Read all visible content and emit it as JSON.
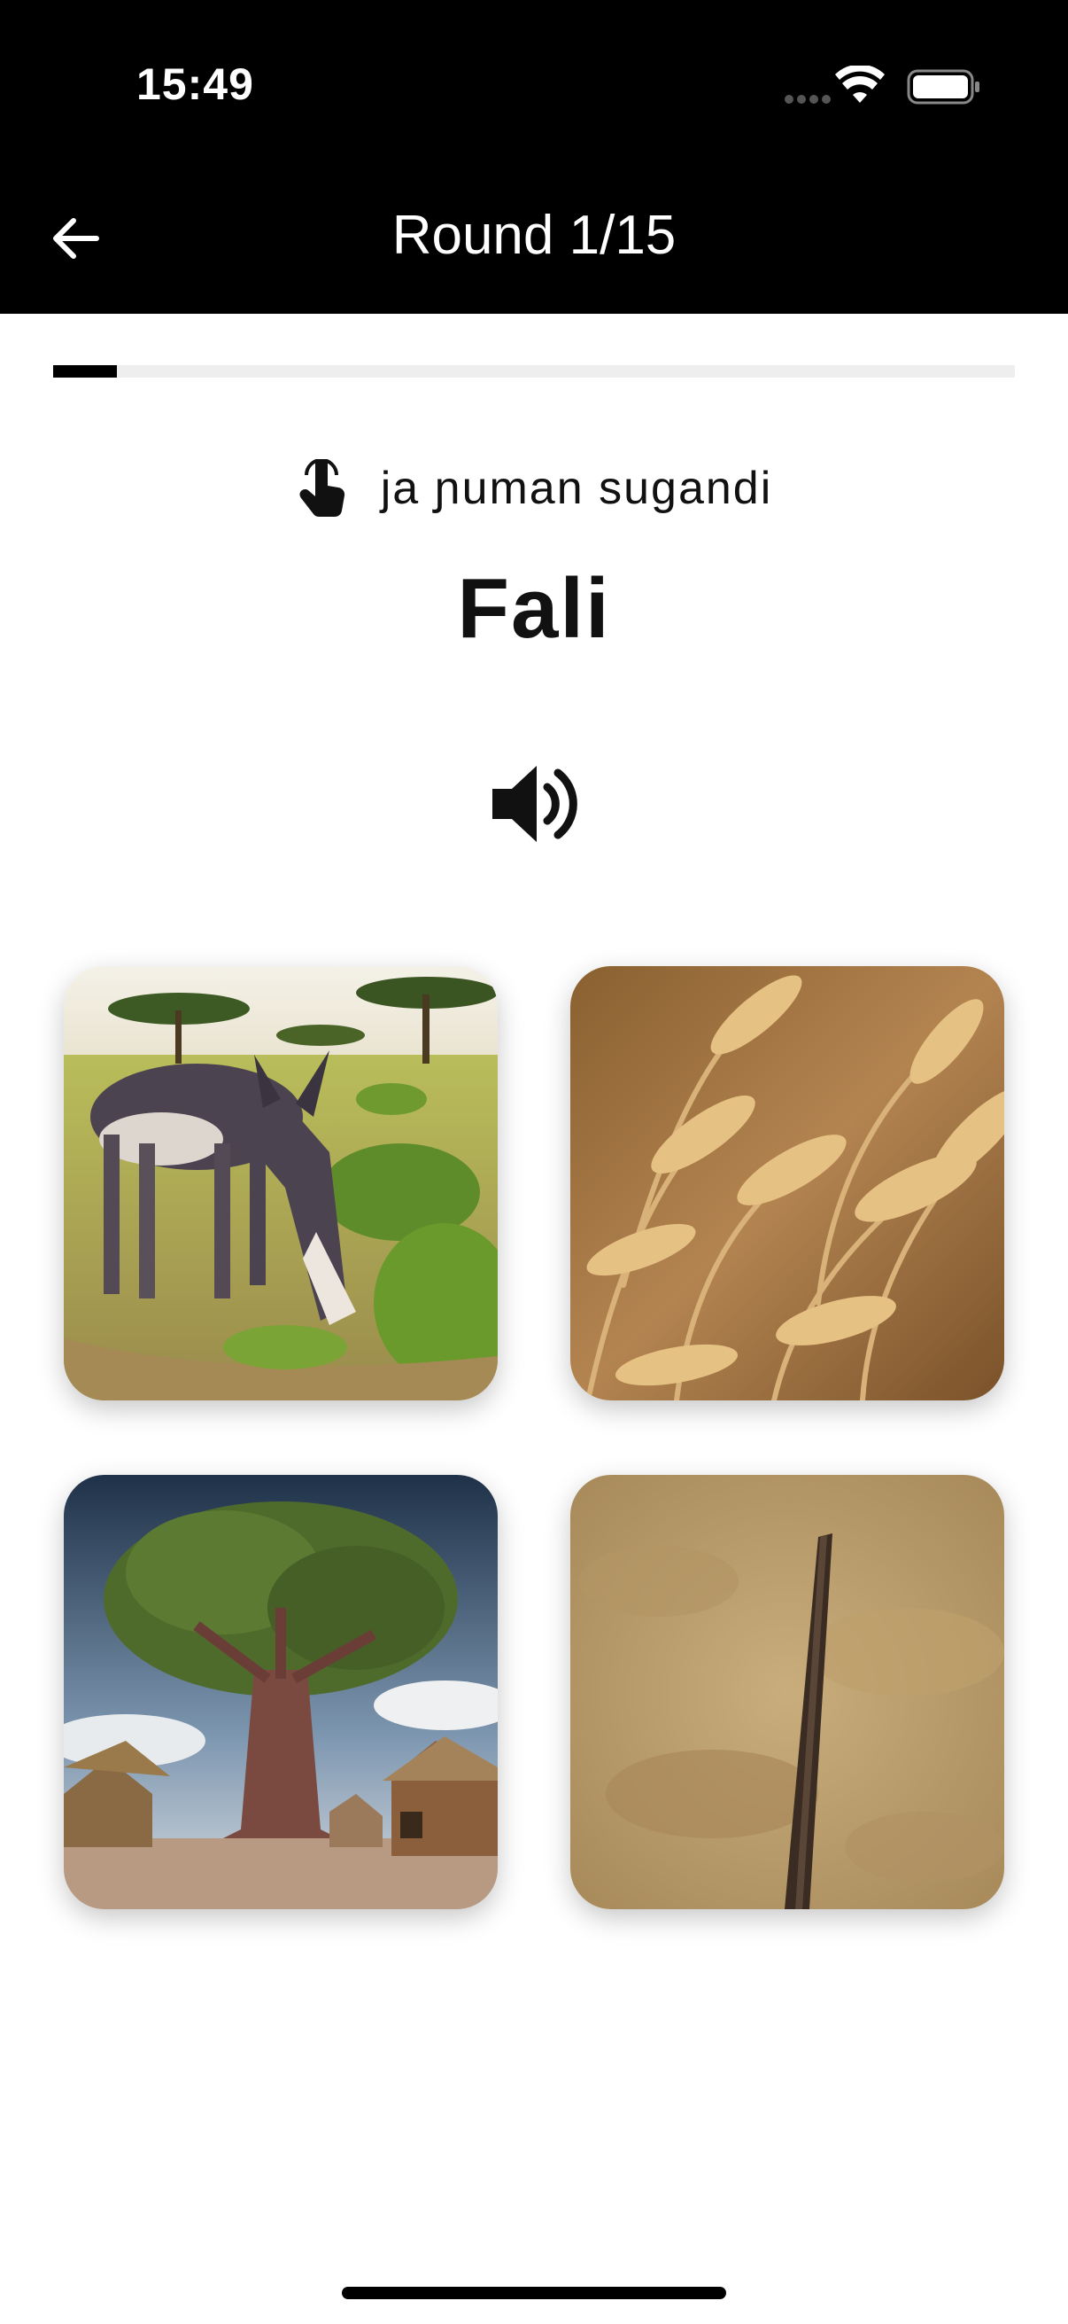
{
  "status_bar": {
    "time": "15:49",
    "icons": [
      "signal-icon",
      "wifi-icon",
      "battery-icon"
    ]
  },
  "header": {
    "back_icon": "arrow-left-icon",
    "title": "Round 1/15"
  },
  "progress": {
    "fraction": 0.0667
  },
  "prompt": {
    "icon": "tap-hand-icon",
    "instruction": "ja ɲuman sugandi",
    "word": "Fali",
    "audio_icon": "speaker-icon"
  },
  "choices": [
    {
      "subject": "donkey grazing in savanna"
    },
    {
      "subject": "wheat field"
    },
    {
      "subject": "baobab tree in village"
    },
    {
      "subject": "stick"
    }
  ],
  "colors": {
    "header_bg": "#000000",
    "progress_fill": "#000000",
    "progress_track": "#eeeeee"
  }
}
